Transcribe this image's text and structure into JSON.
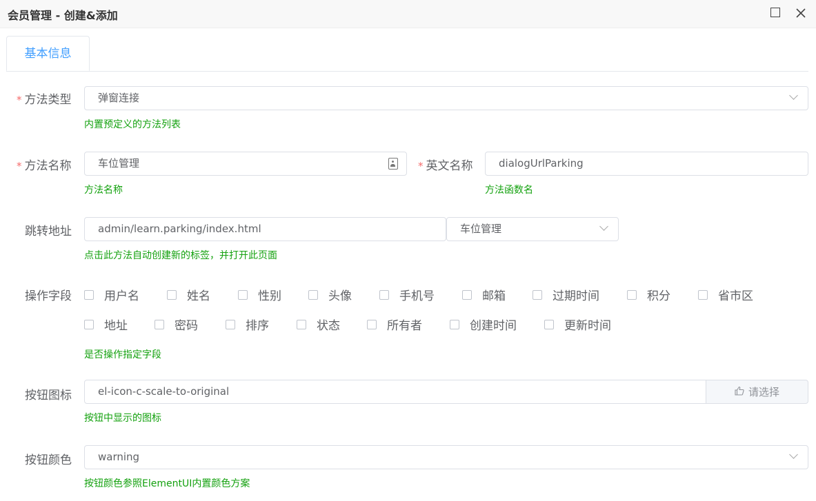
{
  "window": {
    "title": "会员管理 - 创建&添加",
    "maximize_icon": "maximize-icon",
    "close_icon": "close-icon"
  },
  "tabs": [
    {
      "label": "基本信息",
      "active": true
    }
  ],
  "form": {
    "method_type": {
      "label": "方法类型",
      "required": "*",
      "value": "弹窗连接",
      "tip": "内置预定义的方法列表"
    },
    "method_name": {
      "label": "方法名称",
      "required": "*",
      "value": "车位管理",
      "tip": "方法名称"
    },
    "english_name": {
      "label": "英文名称",
      "required": "*",
      "value": "dialogUrlParking",
      "tip": "方法函数名"
    },
    "jump_url": {
      "label": "跳转地址",
      "value": "admin/learn.parking/index.html",
      "select_value": "车位管理",
      "tip": "点击此方法自动创建新的标签，并打开此页面"
    },
    "fields": {
      "label": "操作字段",
      "row1": [
        "用户名",
        "姓名",
        "性别",
        "头像",
        "手机号",
        "邮箱",
        "过期时间",
        "积分",
        "省市区"
      ],
      "row2": [
        "地址",
        "密码",
        "排序",
        "状态",
        "所有者",
        "创建时间",
        "更新时间"
      ],
      "tip": "是否操作指定字段"
    },
    "button_icon": {
      "label": "按钮图标",
      "value": "el-icon-c-scale-to-original",
      "choose_label": "请选择",
      "tip": "按钮中显示的图标"
    },
    "button_color": {
      "label": "按钮颜色",
      "value": "warning",
      "tip": "按钮颜色参照ElementUI内置颜色方案"
    }
  },
  "colors": {
    "accent": "#409eff",
    "required": "#f56c6c",
    "tip": "#13a10e",
    "border": "#dcdfe6"
  }
}
